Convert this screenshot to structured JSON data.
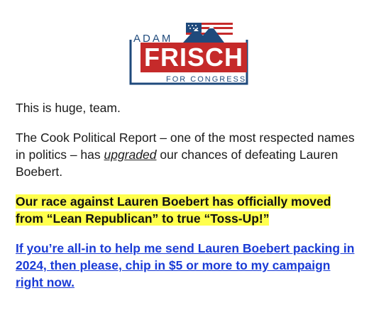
{
  "logo": {
    "top_text": "ADAM",
    "main_text": "FRISCH",
    "bottom_text": "FOR CONGRESS",
    "colors": {
      "red": "#c52a2a",
      "blue": "#1f4a7c"
    },
    "icon": "mountain-flag-icon"
  },
  "email": {
    "p1": "This is huge, team.",
    "p2_before": "The Cook Political Report – one of the most respected names in politics – has ",
    "p2_emph": "upgraded",
    "p2_after": " our chances of defeating Lauren Boebert.",
    "highlight": "Our race against Lauren Boebert has officially moved from “Lean Republican” to true “Toss-Up!”",
    "cta": "If you’re all-in to help me send Lauren Boebert packing in 2024, then please, chip in $5 or more to my campaign right now.",
    "colors": {
      "highlight": "#ffff4d",
      "link": "#1a3bd6"
    }
  }
}
